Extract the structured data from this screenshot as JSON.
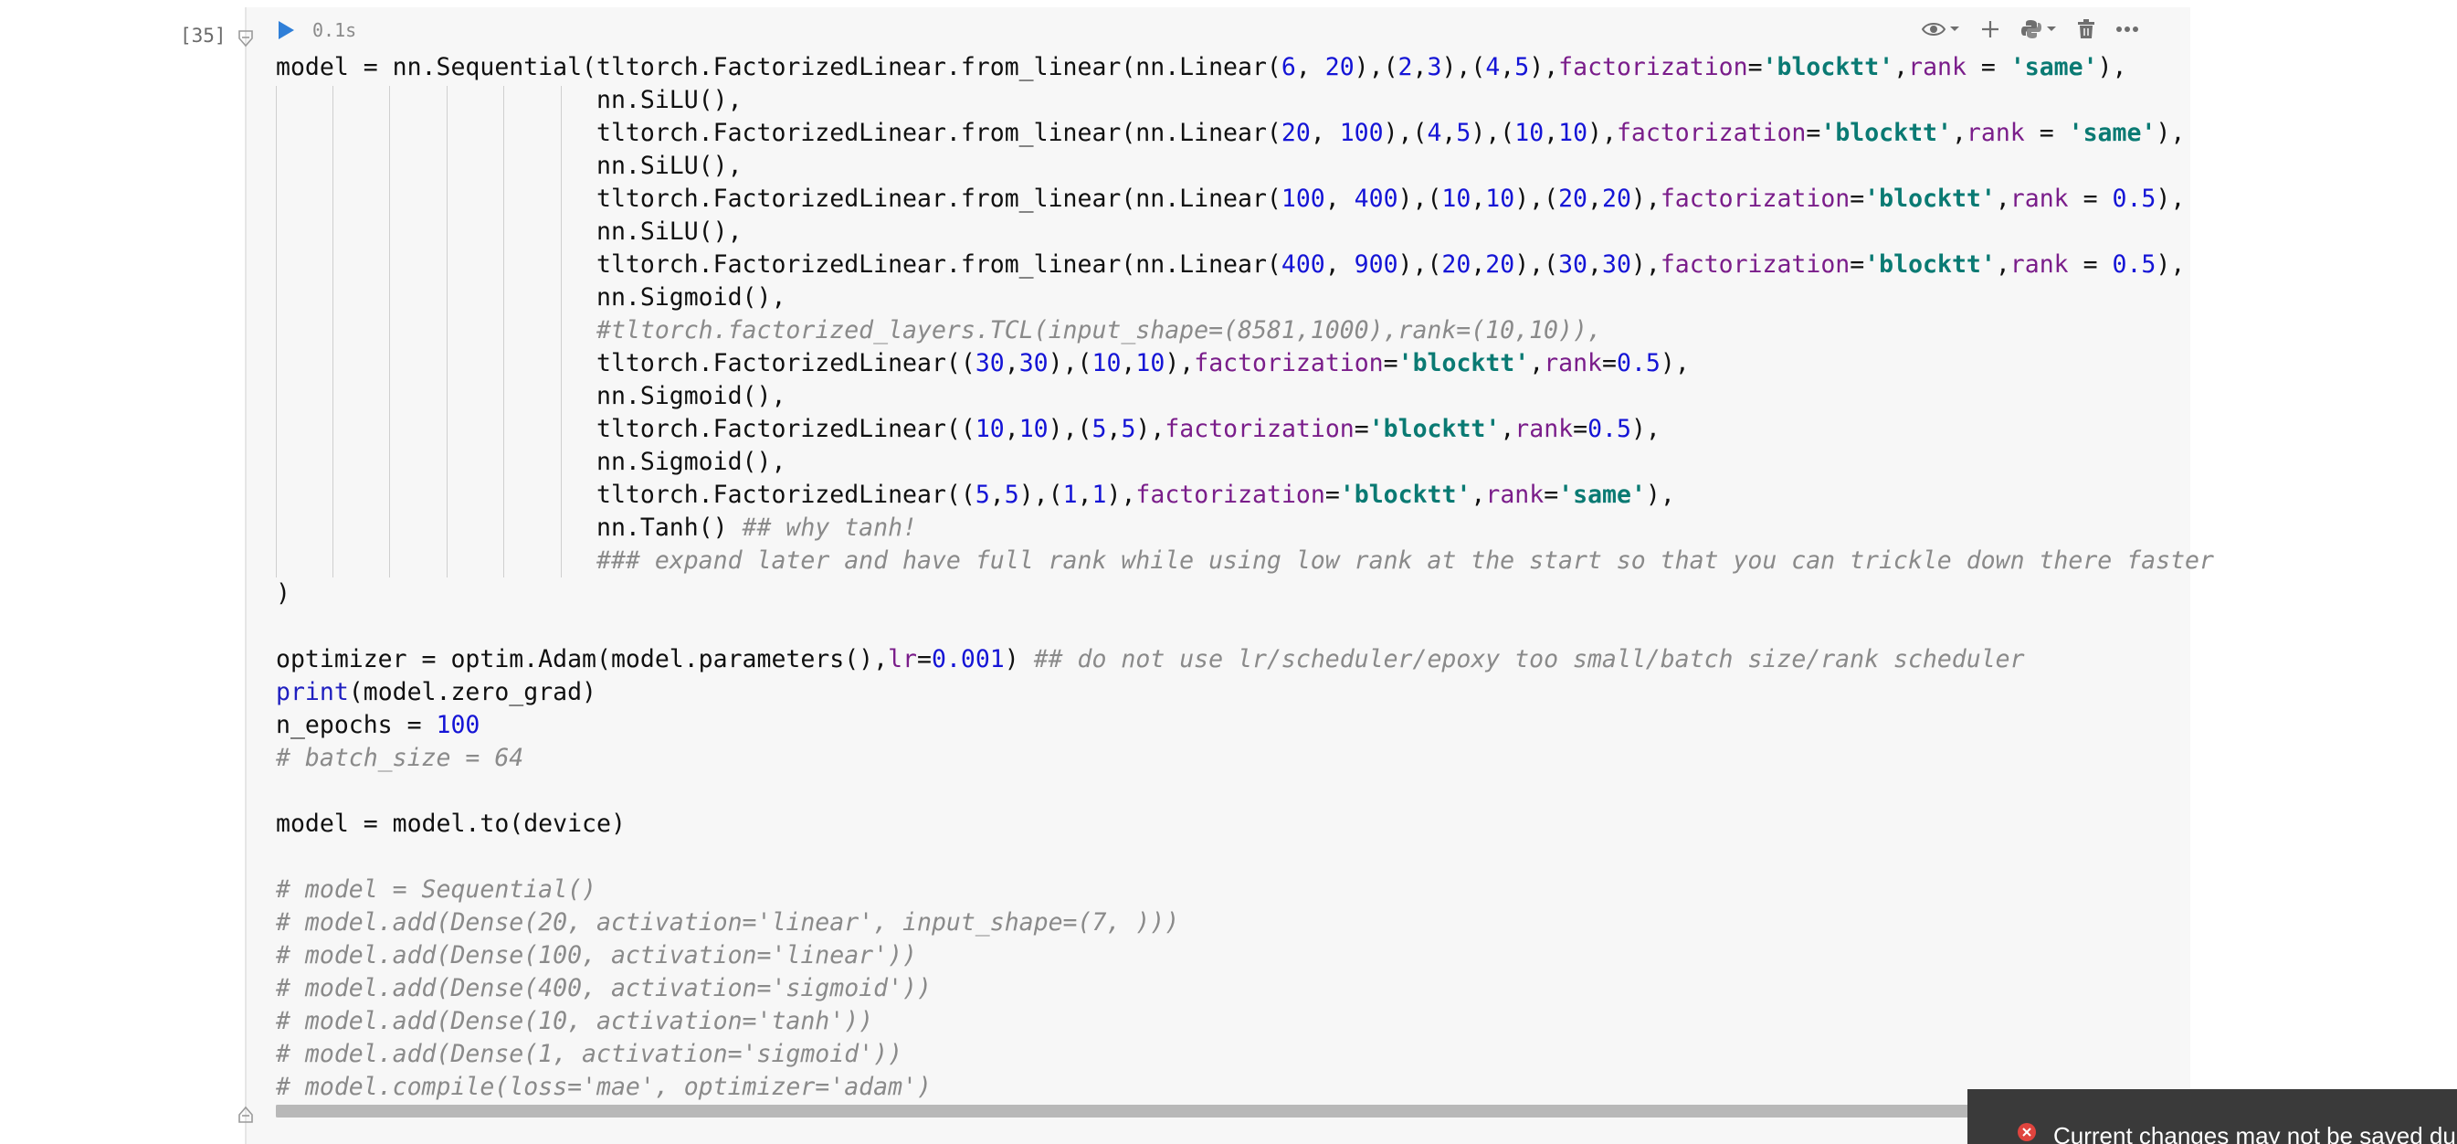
{
  "cell": {
    "execution_count": "[35]",
    "execution_time": "0.1s"
  },
  "toolbar": {
    "icons": [
      "eye-icon",
      "chevron-down-icon",
      "plus-icon",
      "python-icon",
      "chevron-down-icon",
      "trash-icon",
      "more-icon"
    ]
  },
  "code": {
    "lines": [
      "model = nn.Sequential(tltorch.FactorizedLinear.from_linear(nn.Linear(6, 20),(2,3),(4,5),factorization='blocktt',rank = 'same'),",
      "                      nn.SiLU(),",
      "                      tltorch.FactorizedLinear.from_linear(nn.Linear(20, 100),(4,5),(10,10),factorization='blocktt',rank = 'same'),",
      "                      nn.SiLU(),",
      "                      tltorch.FactorizedLinear.from_linear(nn.Linear(100, 400),(10,10),(20,20),factorization='blocktt',rank = 0.5),",
      "                      nn.SiLU(),",
      "                      tltorch.FactorizedLinear.from_linear(nn.Linear(400, 900),(20,20),(30,30),factorization='blocktt',rank = 0.5),",
      "                      nn.Sigmoid(),",
      "                      #tltorch.factorized_layers.TCL(input_shape=(8581,1000),rank=(10,10)),",
      "                      tltorch.FactorizedLinear((30,30),(10,10),factorization='blocktt',rank=0.5),",
      "                      nn.Sigmoid(),",
      "                      tltorch.FactorizedLinear((10,10),(5,5),factorization='blocktt',rank=0.5),",
      "                      nn.Sigmoid(),",
      "                      tltorch.FactorizedLinear((5,5),(1,1),factorization='blocktt',rank='same'),",
      "                      nn.Tanh() ## why tanh!",
      "                      ### expand later and have full rank while using low rank at the start so that you can trickle down there faster",
      ")",
      "",
      "optimizer = optim.Adam(model.parameters(),lr=0.001) ## do not use lr/scheduler/epoxy too small/batch size/rank scheduler",
      "print(model.zero_grad)",
      "n_epochs = 100",
      "# batch_size = 64",
      "",
      "model = model.to(device)",
      "",
      "# model = Sequential()",
      "# model.add(Dense(20, activation='linear', input_shape=(7, )))",
      "# model.add(Dense(100, activation='linear'))",
      "# model.add(Dense(400, activation='sigmoid'))",
      "# model.add(Dense(10, activation='tanh'))",
      "# model.add(Dense(1, activation='sigmoid'))",
      "# model.compile(loss='mae', optimizer='adam')"
    ]
  },
  "notification": {
    "text": "Current changes may not be saved due to an error",
    "icon": "error-icon",
    "color": "#e0443e"
  },
  "colors": {
    "keyword": "#1f1fc0",
    "number": "#1414d6",
    "string": "#0a7a73",
    "param": "#7a1d8a",
    "comment": "#8a8a8a",
    "run_button": "#2f7fd8"
  }
}
